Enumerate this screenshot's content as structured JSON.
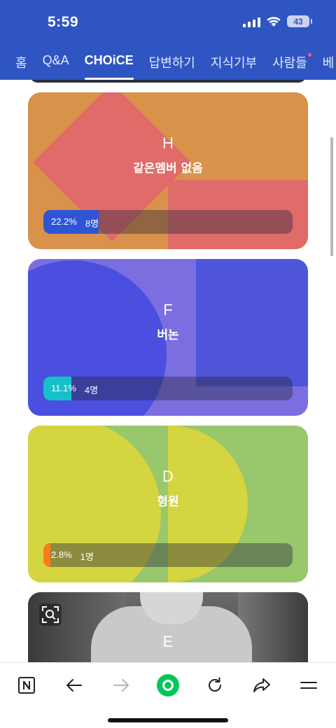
{
  "status_bar": {
    "time": "5:59",
    "battery": "43",
    "icons": [
      "signal-icon",
      "wifi-icon",
      "battery-icon"
    ]
  },
  "nav_tabs": [
    {
      "label": "홈",
      "active": false
    },
    {
      "label": "Q&A",
      "active": false
    },
    {
      "label": "CHOiCE",
      "active": true
    },
    {
      "label": "답변하기",
      "active": false
    },
    {
      "label": "지식기부",
      "active": false
    },
    {
      "label": "사람들",
      "active": false,
      "badge": true
    },
    {
      "label": "베",
      "active": false
    }
  ],
  "choices": [
    {
      "letter": "H",
      "name": "같은멤버 없음",
      "percent": "22.2%",
      "count": "8명",
      "fraction": 0.222,
      "bar_color": "#2f55d6"
    },
    {
      "letter": "F",
      "name": "버논",
      "percent": "11.1%",
      "count": "4명",
      "fraction": 0.111,
      "bar_color": "#16c0c8"
    },
    {
      "letter": "D",
      "name": "형원",
      "percent": "2.8%",
      "count": "1명",
      "fraction": 0.028,
      "bar_color": "#ff7a1a"
    },
    {
      "letter": "E",
      "name": "",
      "percent": "",
      "count": ""
    }
  ],
  "toolbar": {
    "icons": [
      "naver-n-icon",
      "back-arrow-icon",
      "forward-arrow-icon",
      "green-dot-home-icon",
      "refresh-icon",
      "share-icon",
      "menu-icon"
    ]
  },
  "colors": {
    "header": "#2f55c3",
    "accent_green": "#03c75a"
  }
}
